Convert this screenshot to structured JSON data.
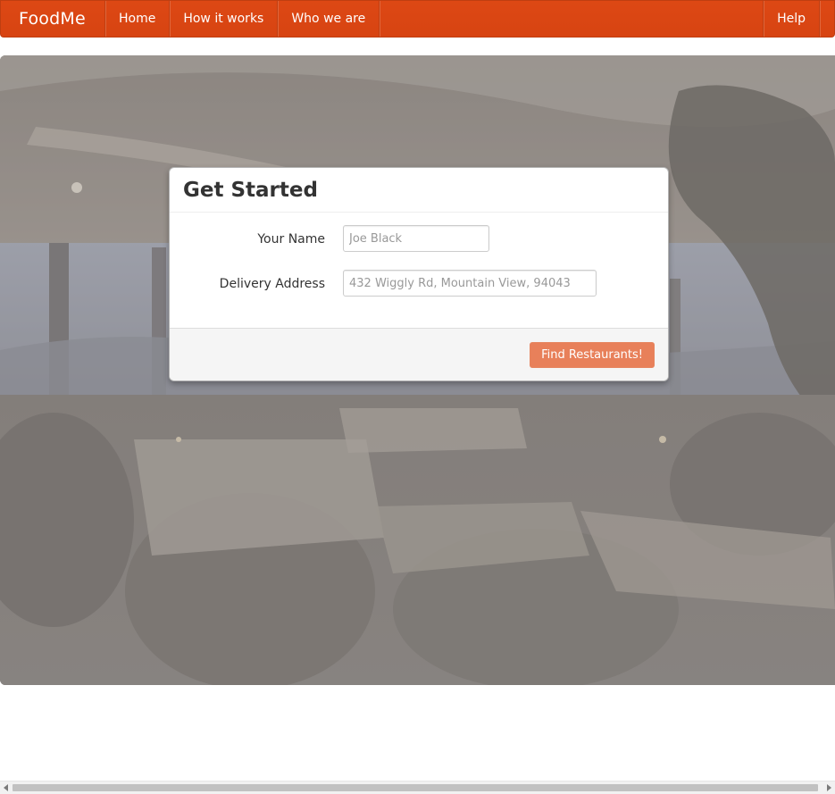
{
  "navbar": {
    "brand": "FoodMe",
    "items": [
      {
        "label": "Home"
      },
      {
        "label": "How it works"
      },
      {
        "label": "Who we are"
      }
    ],
    "help": "Help",
    "color": "#dd4814"
  },
  "card": {
    "title": "Get Started",
    "name_label": "Your Name",
    "name_placeholder": "Joe Black",
    "address_label": "Delivery Address",
    "address_placeholder": "432 Wiggly Rd, Mountain View, 94043",
    "submit_label": "Find Restaurants!",
    "submit_color": "#e8805a"
  },
  "hero": {
    "image_icon": "restaurant-photo-background"
  }
}
